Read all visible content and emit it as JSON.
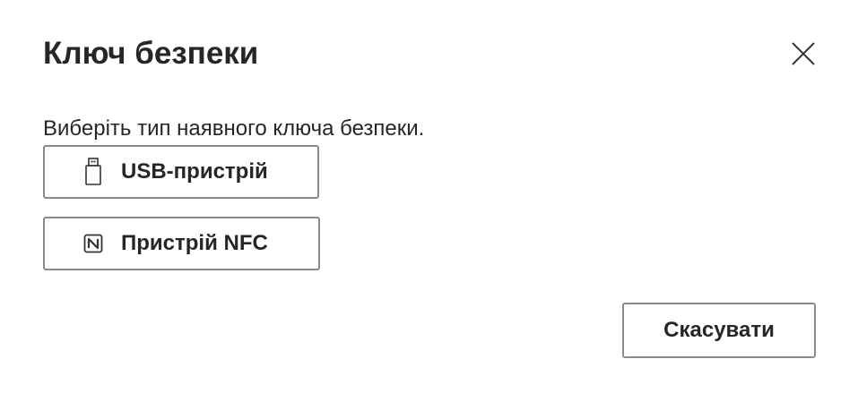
{
  "dialog": {
    "title": "Ключ безпеки",
    "close_icon": "close-icon",
    "subtitle": "Виберіть тип наявного ключа безпеки.",
    "options": [
      {
        "label": "USB-пристрій",
        "icon": "usb-drive-icon"
      },
      {
        "label": "Пристрій NFC",
        "icon": "nfc-icon"
      }
    ],
    "cancel_label": "Скасувати"
  },
  "colors": {
    "text": "#262626",
    "border": "#8a8a8a",
    "background": "#ffffff"
  }
}
